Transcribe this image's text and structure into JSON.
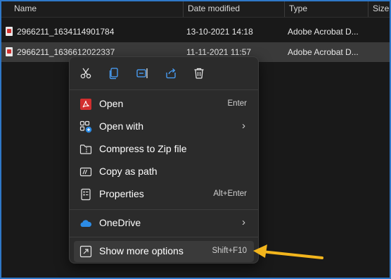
{
  "columns": [
    "Name",
    "Date modified",
    "Type",
    "Size"
  ],
  "files": [
    {
      "name": "2966211_1634114901784",
      "date": "13-10-2021 14:18",
      "type": "Adobe Acrobat D..."
    },
    {
      "name": "2966211_1636612022337",
      "date": "11-11-2021 11:57",
      "type": "Adobe Acrobat D..."
    }
  ],
  "toolbar_icons": [
    "cut-icon",
    "copy-icon",
    "rename-icon",
    "share-icon",
    "delete-icon"
  ],
  "menu": {
    "items": [
      {
        "label": "Open",
        "shortcut": "Enter",
        "icon": "acrobat-icon"
      },
      {
        "label": "Open with",
        "shortcut": "",
        "icon": "open-with-icon",
        "submenu": true
      },
      {
        "label": "Compress to Zip file",
        "shortcut": "",
        "icon": "zip-folder-icon"
      },
      {
        "label": "Copy as path",
        "shortcut": "",
        "icon": "copy-path-icon"
      },
      {
        "label": "Properties",
        "shortcut": "Alt+Enter",
        "icon": "properties-icon"
      }
    ],
    "onedrive": {
      "label": "OneDrive",
      "icon": "onedrive-icon",
      "submenu": true
    },
    "more": {
      "label": "Show more options",
      "shortcut": "Shift+F10",
      "icon": "more-options-icon"
    }
  },
  "colors": {
    "accent_border": "#2f78c8",
    "arrow": "#f2b51d",
    "acrobat_red": "#d22f2f",
    "onedrive_blue": "#2c8ce6"
  }
}
